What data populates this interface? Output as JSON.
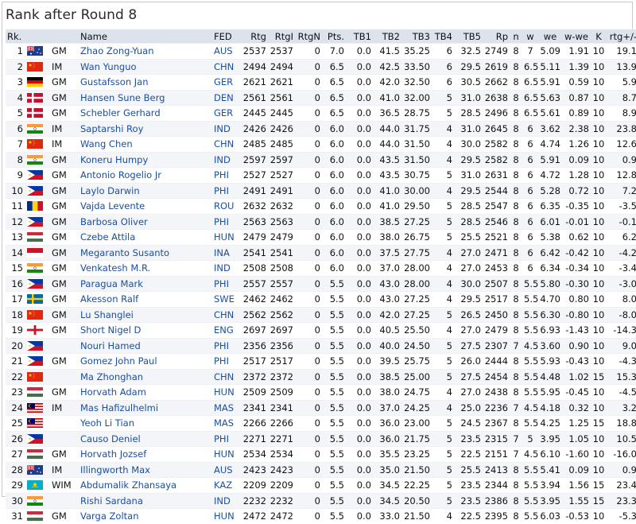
{
  "title": "Rank after Round 8",
  "columns": [
    "Rk.",
    "",
    "",
    "Name",
    "FED",
    "Rtg",
    "RtgI",
    "RtgN",
    "Pts.",
    "TB1",
    "TB2",
    "TB3",
    "TB4",
    "TB5",
    "Rp",
    "n",
    "w",
    "we",
    "w-we",
    "K",
    "rtg+/-"
  ],
  "rows": [
    {
      "rk": "1",
      "flag": "aus",
      "title": "GM",
      "name": "Zhao Zong-Yuan",
      "fed": "AUS",
      "rtg": "2537",
      "rtgi": "2537",
      "rtgn": "0",
      "pts": "7.0",
      "tb1": "0.0",
      "tb2": "41.5",
      "tb3": "35.25",
      "tb4": "6",
      "tb5": "32.5",
      "rp": "2749",
      "n": "8",
      "w": "7",
      "we": "5.09",
      "wwe": "1.91",
      "k": "10",
      "d": "19.1"
    },
    {
      "rk": "2",
      "flag": "chn",
      "title": "IM",
      "name": "Wan Yunguo",
      "fed": "CHN",
      "rtg": "2494",
      "rtgi": "2494",
      "rtgn": "0",
      "pts": "6.5",
      "tb1": "0.0",
      "tb2": "42.5",
      "tb3": "33.50",
      "tb4": "6",
      "tb5": "29.5",
      "rp": "2619",
      "n": "8",
      "w": "6.5",
      "we": "5.11",
      "wwe": "1.39",
      "k": "10",
      "d": "13.9"
    },
    {
      "rk": "3",
      "flag": "ger",
      "title": "GM",
      "name": "Gustafsson Jan",
      "fed": "GER",
      "rtg": "2621",
      "rtgi": "2621",
      "rtgn": "0",
      "pts": "6.5",
      "tb1": "0.0",
      "tb2": "42.0",
      "tb3": "32.50",
      "tb4": "6",
      "tb5": "30.5",
      "rp": "2662",
      "n": "8",
      "w": "6.5",
      "we": "5.91",
      "wwe": "0.59",
      "k": "10",
      "d": "5.9"
    },
    {
      "rk": "4",
      "flag": "den",
      "title": "GM",
      "name": "Hansen Sune Berg",
      "fed": "DEN",
      "rtg": "2561",
      "rtgi": "2561",
      "rtgn": "0",
      "pts": "6.5",
      "tb1": "0.0",
      "tb2": "41.0",
      "tb3": "32.00",
      "tb4": "5",
      "tb5": "31.0",
      "rp": "2638",
      "n": "8",
      "w": "6.5",
      "we": "5.63",
      "wwe": "0.87",
      "k": "10",
      "d": "8.7"
    },
    {
      "rk": "5",
      "flag": "den",
      "title": "GM",
      "name": "Schebler Gerhard",
      "fed": "GER",
      "rtg": "2445",
      "rtgi": "2445",
      "rtgn": "0",
      "pts": "6.5",
      "tb1": "0.0",
      "tb2": "36.5",
      "tb3": "28.75",
      "tb4": "5",
      "tb5": "28.5",
      "rp": "2496",
      "n": "8",
      "w": "6.5",
      "we": "5.61",
      "wwe": "0.89",
      "k": "10",
      "d": "8.9"
    },
    {
      "rk": "6",
      "flag": "ind",
      "title": "IM",
      "name": "Saptarshi Roy",
      "fed": "IND",
      "rtg": "2426",
      "rtgi": "2426",
      "rtgn": "0",
      "pts": "6.0",
      "tb1": "0.0",
      "tb2": "44.0",
      "tb3": "31.75",
      "tb4": "4",
      "tb5": "31.0",
      "rp": "2645",
      "n": "8",
      "w": "6",
      "we": "3.62",
      "wwe": "2.38",
      "k": "10",
      "d": "23.8"
    },
    {
      "rk": "7",
      "flag": "chn",
      "title": "IM",
      "name": "Wang Chen",
      "fed": "CHN",
      "rtg": "2485",
      "rtgi": "2485",
      "rtgn": "0",
      "pts": "6.0",
      "tb1": "0.0",
      "tb2": "44.0",
      "tb3": "31.50",
      "tb4": "4",
      "tb5": "30.0",
      "rp": "2582",
      "n": "8",
      "w": "6",
      "we": "4.74",
      "wwe": "1.26",
      "k": "10",
      "d": "12.6"
    },
    {
      "rk": "8",
      "flag": "ind",
      "title": "GM",
      "name": "Koneru Humpy",
      "fed": "IND",
      "rtg": "2597",
      "rtgi": "2597",
      "rtgn": "0",
      "pts": "6.0",
      "tb1": "0.0",
      "tb2": "43.5",
      "tb3": "31.50",
      "tb4": "4",
      "tb5": "29.5",
      "rp": "2582",
      "n": "8",
      "w": "6",
      "we": "5.91",
      "wwe": "0.09",
      "k": "10",
      "d": "0.9"
    },
    {
      "rk": "9",
      "flag": "phi",
      "title": "GM",
      "name": "Antonio Rogelio Jr",
      "fed": "PHI",
      "rtg": "2527",
      "rtgi": "2527",
      "rtgn": "0",
      "pts": "6.0",
      "tb1": "0.0",
      "tb2": "43.5",
      "tb3": "30.75",
      "tb4": "5",
      "tb5": "31.0",
      "rp": "2631",
      "n": "8",
      "w": "6",
      "we": "4.72",
      "wwe": "1.28",
      "k": "10",
      "d": "12.8"
    },
    {
      "rk": "10",
      "flag": "phi",
      "title": "GM",
      "name": "Laylo Darwin",
      "fed": "PHI",
      "rtg": "2491",
      "rtgi": "2491",
      "rtgn": "0",
      "pts": "6.0",
      "tb1": "0.0",
      "tb2": "41.0",
      "tb3": "30.00",
      "tb4": "4",
      "tb5": "29.5",
      "rp": "2544",
      "n": "8",
      "w": "6",
      "we": "5.28",
      "wwe": "0.72",
      "k": "10",
      "d": "7.2"
    },
    {
      "rk": "11",
      "flag": "rou",
      "title": "GM",
      "name": "Vajda Levente",
      "fed": "ROU",
      "rtg": "2632",
      "rtgi": "2632",
      "rtgn": "0",
      "pts": "6.0",
      "tb1": "0.0",
      "tb2": "41.0",
      "tb3": "29.50",
      "tb4": "5",
      "tb5": "28.5",
      "rp": "2547",
      "n": "8",
      "w": "6",
      "we": "6.35",
      "wwe": "-0.35",
      "k": "10",
      "d": "-3.5"
    },
    {
      "rk": "12",
      "flag": "phi",
      "title": "GM",
      "name": "Barbosa Oliver",
      "fed": "PHI",
      "rtg": "2563",
      "rtgi": "2563",
      "rtgn": "0",
      "pts": "6.0",
      "tb1": "0.0",
      "tb2": "38.5",
      "tb3": "27.25",
      "tb4": "5",
      "tb5": "28.5",
      "rp": "2546",
      "n": "8",
      "w": "6",
      "we": "6.01",
      "wwe": "-0.01",
      "k": "10",
      "d": "-0.1"
    },
    {
      "rk": "13",
      "flag": "hun",
      "title": "GM",
      "name": "Czebe Attila",
      "fed": "HUN",
      "rtg": "2479",
      "rtgi": "2479",
      "rtgn": "0",
      "pts": "6.0",
      "tb1": "0.0",
      "tb2": "38.0",
      "tb3": "26.75",
      "tb4": "5",
      "tb5": "25.5",
      "rp": "2521",
      "n": "8",
      "w": "6",
      "we": "5.38",
      "wwe": "0.62",
      "k": "10",
      "d": "6.2"
    },
    {
      "rk": "14",
      "flag": "ina",
      "title": "GM",
      "name": "Megaranto Susanto",
      "fed": "INA",
      "rtg": "2541",
      "rtgi": "2541",
      "rtgn": "0",
      "pts": "6.0",
      "tb1": "0.0",
      "tb2": "37.5",
      "tb3": "27.75",
      "tb4": "4",
      "tb5": "27.0",
      "rp": "2471",
      "n": "8",
      "w": "6",
      "we": "6.42",
      "wwe": "-0.42",
      "k": "10",
      "d": "-4.2"
    },
    {
      "rk": "15",
      "flag": "ind",
      "title": "GM",
      "name": "Venkatesh M.R.",
      "fed": "IND",
      "rtg": "2508",
      "rtgi": "2508",
      "rtgn": "0",
      "pts": "6.0",
      "tb1": "0.0",
      "tb2": "37.0",
      "tb3": "28.00",
      "tb4": "4",
      "tb5": "27.0",
      "rp": "2453",
      "n": "8",
      "w": "6",
      "we": "6.34",
      "wwe": "-0.34",
      "k": "10",
      "d": "-3.4"
    },
    {
      "rk": "16",
      "flag": "phi",
      "title": "GM",
      "name": "Paragua Mark",
      "fed": "PHI",
      "rtg": "2557",
      "rtgi": "2557",
      "rtgn": "0",
      "pts": "5.5",
      "tb1": "0.0",
      "tb2": "43.0",
      "tb3": "28.00",
      "tb4": "4",
      "tb5": "30.0",
      "rp": "2507",
      "n": "8",
      "w": "5.5",
      "we": "5.80",
      "wwe": "-0.30",
      "k": "10",
      "d": "-3.0"
    },
    {
      "rk": "17",
      "flag": "swe",
      "title": "GM",
      "name": "Akesson Ralf",
      "fed": "SWE",
      "rtg": "2462",
      "rtgi": "2462",
      "rtgn": "0",
      "pts": "5.5",
      "tb1": "0.0",
      "tb2": "43.0",
      "tb3": "27.25",
      "tb4": "4",
      "tb5": "29.5",
      "rp": "2517",
      "n": "8",
      "w": "5.5",
      "we": "4.70",
      "wwe": "0.80",
      "k": "10",
      "d": "8.0"
    },
    {
      "rk": "18",
      "flag": "chn",
      "title": "GM",
      "name": "Lu Shanglei",
      "fed": "CHN",
      "rtg": "2562",
      "rtgi": "2562",
      "rtgn": "0",
      "pts": "5.5",
      "tb1": "0.0",
      "tb2": "42.0",
      "tb3": "27.25",
      "tb4": "5",
      "tb5": "26.5",
      "rp": "2450",
      "n": "8",
      "w": "5.5",
      "we": "6.30",
      "wwe": "-0.80",
      "k": "10",
      "d": "-8.0"
    },
    {
      "rk": "19",
      "flag": "eng",
      "title": "GM",
      "name": "Short Nigel D",
      "fed": "ENG",
      "rtg": "2697",
      "rtgi": "2697",
      "rtgn": "0",
      "pts": "5.5",
      "tb1": "0.0",
      "tb2": "40.5",
      "tb3": "25.50",
      "tb4": "4",
      "tb5": "27.0",
      "rp": "2479",
      "n": "8",
      "w": "5.5",
      "we": "6.93",
      "wwe": "-1.43",
      "k": "10",
      "d": "-14.3"
    },
    {
      "rk": "20",
      "flag": "phi",
      "title": "",
      "name": "Nouri Hamed",
      "fed": "PHI",
      "rtg": "2356",
      "rtgi": "2356",
      "rtgn": "0",
      "pts": "5.5",
      "tb1": "0.0",
      "tb2": "40.0",
      "tb3": "24.50",
      "tb4": "5",
      "tb5": "27.5",
      "rp": "2307",
      "n": "7",
      "w": "4.5",
      "we": "3.60",
      "wwe": "0.90",
      "k": "10",
      "d": "9.0"
    },
    {
      "rk": "21",
      "flag": "phi",
      "title": "GM",
      "name": "Gomez John Paul",
      "fed": "PHI",
      "rtg": "2517",
      "rtgi": "2517",
      "rtgn": "0",
      "pts": "5.5",
      "tb1": "0.0",
      "tb2": "39.5",
      "tb3": "25.75",
      "tb4": "5",
      "tb5": "26.0",
      "rp": "2444",
      "n": "8",
      "w": "5.5",
      "we": "5.93",
      "wwe": "-0.43",
      "k": "10",
      "d": "-4.3"
    },
    {
      "rk": "22",
      "flag": "chn",
      "title": "",
      "name": "Ma Zhonghan",
      "fed": "CHN",
      "rtg": "2372",
      "rtgi": "2372",
      "rtgn": "0",
      "pts": "5.5",
      "tb1": "0.0",
      "tb2": "38.5",
      "tb3": "25.00",
      "tb4": "5",
      "tb5": "27.5",
      "rp": "2454",
      "n": "8",
      "w": "5.5",
      "we": "4.48",
      "wwe": "1.02",
      "k": "15",
      "d": "15.3"
    },
    {
      "rk": "23",
      "flag": "hun",
      "title": "GM",
      "name": "Horvath Adam",
      "fed": "HUN",
      "rtg": "2509",
      "rtgi": "2509",
      "rtgn": "0",
      "pts": "5.5",
      "tb1": "0.0",
      "tb2": "38.0",
      "tb3": "24.75",
      "tb4": "4",
      "tb5": "27.0",
      "rp": "2438",
      "n": "8",
      "w": "5.5",
      "we": "5.95",
      "wwe": "-0.45",
      "k": "10",
      "d": "-4.5"
    },
    {
      "rk": "24",
      "flag": "mas",
      "title": "IM",
      "name": "Mas Hafizulhelmi",
      "fed": "MAS",
      "rtg": "2341",
      "rtgi": "2341",
      "rtgn": "0",
      "pts": "5.5",
      "tb1": "0.0",
      "tb2": "37.0",
      "tb3": "24.25",
      "tb4": "4",
      "tb5": "25.0",
      "rp": "2236",
      "n": "7",
      "w": "4.5",
      "we": "4.18",
      "wwe": "0.32",
      "k": "10",
      "d": "3.2"
    },
    {
      "rk": "25",
      "flag": "mas",
      "title": "",
      "name": "Yeoh Li Tian",
      "fed": "MAS",
      "rtg": "2266",
      "rtgi": "2266",
      "rtgn": "0",
      "pts": "5.5",
      "tb1": "0.0",
      "tb2": "36.0",
      "tb3": "23.00",
      "tb4": "5",
      "tb5": "24.5",
      "rp": "2367",
      "n": "8",
      "w": "5.5",
      "we": "4.25",
      "wwe": "1.25",
      "k": "15",
      "d": "18.8"
    },
    {
      "rk": "26",
      "flag": "phi",
      "title": "",
      "name": "Causo Deniel",
      "fed": "PHI",
      "rtg": "2271",
      "rtgi": "2271",
      "rtgn": "0",
      "pts": "5.5",
      "tb1": "0.0",
      "tb2": "36.0",
      "tb3": "21.75",
      "tb4": "5",
      "tb5": "23.5",
      "rp": "2315",
      "n": "7",
      "w": "5",
      "we": "3.95",
      "wwe": "1.05",
      "k": "10",
      "d": "10.5"
    },
    {
      "rk": "27",
      "flag": "hun",
      "title": "GM",
      "name": "Horvath Jozsef",
      "fed": "HUN",
      "rtg": "2534",
      "rtgi": "2534",
      "rtgn": "0",
      "pts": "5.5",
      "tb1": "0.0",
      "tb2": "35.5",
      "tb3": "23.25",
      "tb4": "5",
      "tb5": "22.5",
      "rp": "2151",
      "n": "7",
      "w": "4.5",
      "we": "6.10",
      "wwe": "-1.60",
      "k": "10",
      "d": "-16.0"
    },
    {
      "rk": "28",
      "flag": "aus",
      "title": "IM",
      "name": "Illingworth Max",
      "fed": "AUS",
      "rtg": "2423",
      "rtgi": "2423",
      "rtgn": "0",
      "pts": "5.5",
      "tb1": "0.0",
      "tb2": "35.0",
      "tb3": "21.50",
      "tb4": "5",
      "tb5": "25.5",
      "rp": "2413",
      "n": "8",
      "w": "5.5",
      "we": "5.41",
      "wwe": "0.09",
      "k": "10",
      "d": "0.9"
    },
    {
      "rk": "29",
      "flag": "kaz",
      "title": "WIM",
      "name": "Abdumalik Zhansaya",
      "fed": "KAZ",
      "rtg": "2209",
      "rtgi": "2209",
      "rtgn": "0",
      "pts": "5.5",
      "tb1": "0.0",
      "tb2": "34.5",
      "tb3": "22.25",
      "tb4": "5",
      "tb5": "23.5",
      "rp": "2344",
      "n": "8",
      "w": "5.5",
      "we": "3.94",
      "wwe": "1.56",
      "k": "15",
      "d": "23.4"
    },
    {
      "rk": "30",
      "flag": "ind",
      "title": "",
      "name": "Rishi Sardana",
      "fed": "IND",
      "rtg": "2232",
      "rtgi": "2232",
      "rtgn": "0",
      "pts": "5.5",
      "tb1": "0.0",
      "tb2": "34.5",
      "tb3": "20.50",
      "tb4": "5",
      "tb5": "23.5",
      "rp": "2386",
      "n": "8",
      "w": "5.5",
      "we": "3.95",
      "wwe": "1.55",
      "k": "15",
      "d": "23.3"
    },
    {
      "rk": "31",
      "flag": "hun",
      "title": "GM",
      "name": "Varga Zoltan",
      "fed": "HUN",
      "rtg": "2472",
      "rtgi": "2472",
      "rtgn": "0",
      "pts": "5.5",
      "tb1": "0.0",
      "tb2": "33.0",
      "tb3": "21.50",
      "tb4": "4",
      "tb5": "22.5",
      "rp": "2395",
      "n": "8",
      "w": "5.5",
      "we": "6.03",
      "wwe": "-0.53",
      "k": "10",
      "d": "-5.3"
    }
  ],
  "colors": {
    "header_bg": "#dde3ec",
    "row_alt": "#f3f5f8",
    "link": "#1a4fa0"
  }
}
